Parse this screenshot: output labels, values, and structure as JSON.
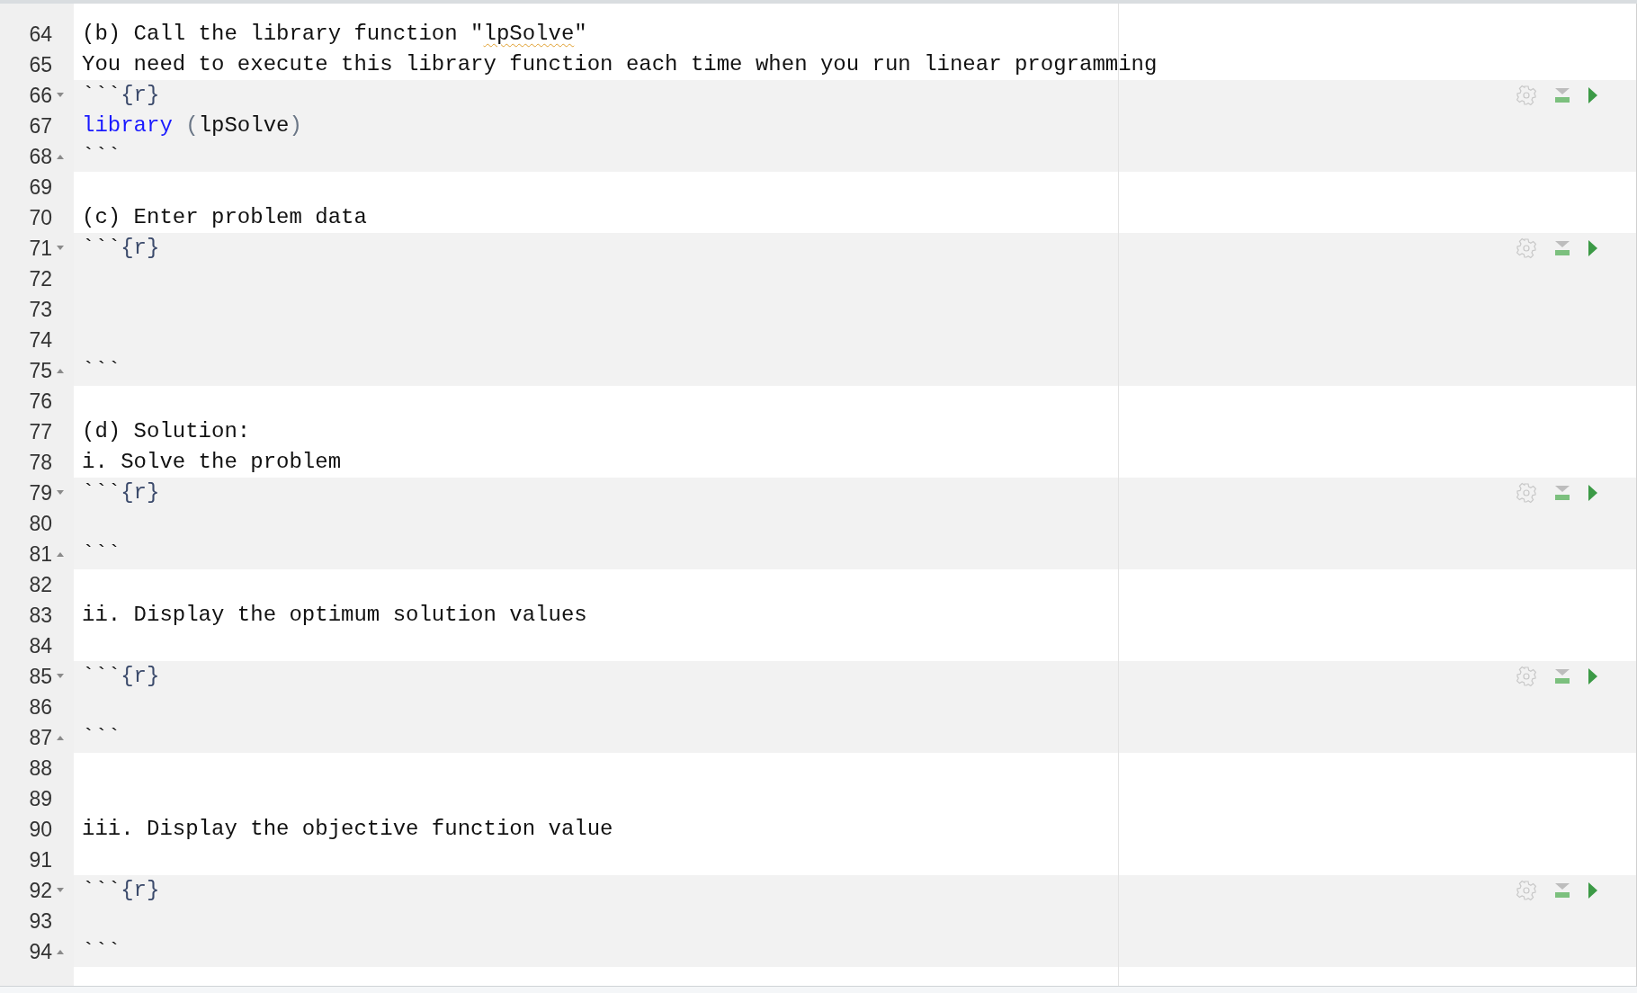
{
  "editor": {
    "lines": [
      {
        "number": "64",
        "kind": "text",
        "tokens": [
          {
            "text": "(b) Call the library function \"",
            "kind": "plain"
          },
          {
            "text": "lpSolve",
            "kind": "misspelled"
          },
          {
            "text": "\"",
            "kind": "plain"
          }
        ]
      },
      {
        "number": "65",
        "kind": "text",
        "tokens": [
          {
            "text": "You need to execute this library function each time when you run linear programming",
            "kind": "plain"
          }
        ]
      },
      {
        "number": "66",
        "kind": "chunk_start",
        "tokens": [
          {
            "text": "```",
            "kind": "plain"
          },
          {
            "text": "{r}",
            "kind": "header"
          }
        ]
      },
      {
        "number": "67",
        "kind": "chunk_line",
        "tokens": [
          {
            "text": "library ",
            "kind": "keyword"
          },
          {
            "text": "(",
            "kind": "paren"
          },
          {
            "text": "lpSolve",
            "kind": "plain"
          },
          {
            "text": ")",
            "kind": "paren"
          }
        ]
      },
      {
        "number": "68",
        "kind": "chunk_end",
        "tokens": [
          {
            "text": "```",
            "kind": "plain"
          }
        ]
      },
      {
        "number": "69",
        "kind": "blank"
      },
      {
        "number": "70",
        "kind": "text",
        "tokens": [
          {
            "text": "(c) Enter problem data",
            "kind": "plain"
          }
        ]
      },
      {
        "number": "71",
        "kind": "chunk_start",
        "tokens": [
          {
            "text": "```",
            "kind": "plain"
          },
          {
            "text": "{r}",
            "kind": "header"
          }
        ]
      },
      {
        "number": "72",
        "kind": "chunk_line"
      },
      {
        "number": "73",
        "kind": "chunk_line"
      },
      {
        "number": "74",
        "kind": "chunk_line"
      },
      {
        "number": "75",
        "kind": "chunk_end",
        "tokens": [
          {
            "text": "```",
            "kind": "plain"
          }
        ]
      },
      {
        "number": "76",
        "kind": "blank"
      },
      {
        "number": "77",
        "kind": "text",
        "tokens": [
          {
            "text": "(d) Solution:",
            "kind": "plain"
          }
        ]
      },
      {
        "number": "78",
        "kind": "text",
        "tokens": [
          {
            "text": "i. Solve the problem",
            "kind": "plain"
          }
        ]
      },
      {
        "number": "79",
        "kind": "chunk_start",
        "tokens": [
          {
            "text": "```",
            "kind": "plain"
          },
          {
            "text": "{r}",
            "kind": "header"
          }
        ]
      },
      {
        "number": "80",
        "kind": "chunk_line"
      },
      {
        "number": "81",
        "kind": "chunk_end",
        "tokens": [
          {
            "text": "```",
            "kind": "plain"
          }
        ]
      },
      {
        "number": "82",
        "kind": "blank"
      },
      {
        "number": "83",
        "kind": "text",
        "tokens": [
          {
            "text": "ii. Display the optimum solution values",
            "kind": "plain"
          }
        ]
      },
      {
        "number": "84",
        "kind": "blank"
      },
      {
        "number": "85",
        "kind": "chunk_start",
        "tokens": [
          {
            "text": "```",
            "kind": "plain"
          },
          {
            "text": "{r}",
            "kind": "header"
          }
        ]
      },
      {
        "number": "86",
        "kind": "chunk_line"
      },
      {
        "number": "87",
        "kind": "chunk_end",
        "tokens": [
          {
            "text": "```",
            "kind": "plain"
          }
        ]
      },
      {
        "number": "88",
        "kind": "blank"
      },
      {
        "number": "89",
        "kind": "blank"
      },
      {
        "number": "90",
        "kind": "text",
        "tokens": [
          {
            "text": "iii. Display the objective function value",
            "kind": "plain"
          }
        ]
      },
      {
        "number": "91",
        "kind": "blank"
      },
      {
        "number": "92",
        "kind": "chunk_start",
        "tokens": [
          {
            "text": "```",
            "kind": "plain"
          },
          {
            "text": "{r}",
            "kind": "header"
          }
        ]
      },
      {
        "number": "93",
        "kind": "chunk_line"
      },
      {
        "number": "94",
        "kind": "chunk_end",
        "tokens": [
          {
            "text": "```",
            "kind": "plain"
          }
        ]
      }
    ]
  }
}
